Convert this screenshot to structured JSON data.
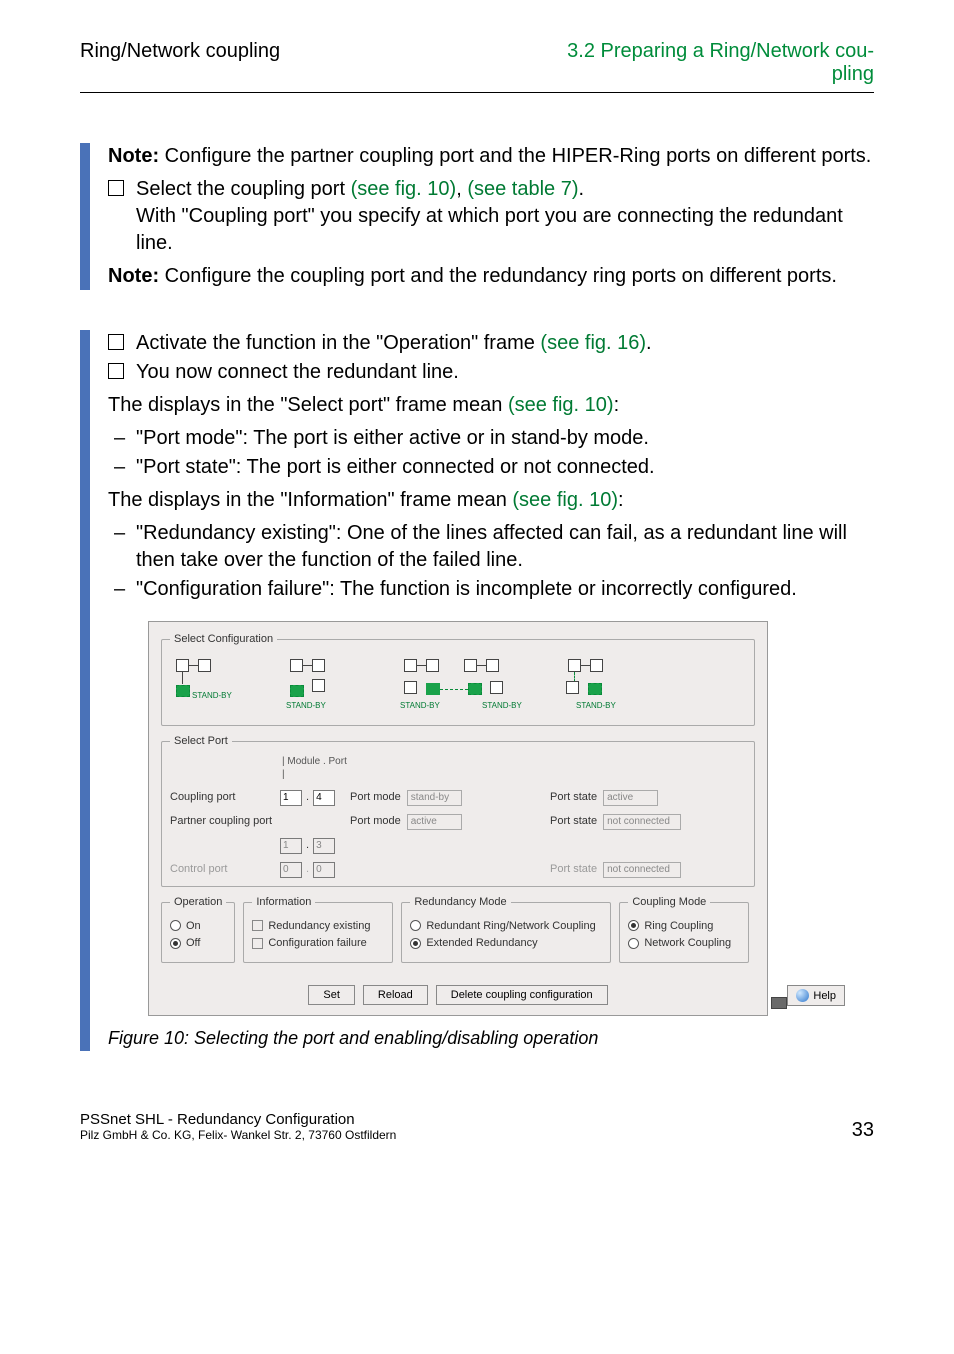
{
  "header": {
    "left": "Ring/Network coupling",
    "right_line1": "3.2  Preparing a Ring/Network cou-",
    "right_line2": "pling"
  },
  "body": {
    "note1_label": "Note:",
    "note1_text": " Configure the partner coupling port and the HIPER-Ring ports on different ports.",
    "check1a": "Select the coupling port ",
    "check1_link1": "(see fig. 10)",
    "check1_sep": ", ",
    "check1_link2": "(see table 7)",
    "check1_end": ".",
    "check1_sub": "With \"Coupling port\" you specify at which port you are connecting the redundant line.",
    "note2_label": "Note:",
    "note2_text": " Configure the coupling port and the redundancy ring ports on different ports.",
    "check2": "Activate the function in the \"Operation\" frame ",
    "check2_link": "(see fig. 16)",
    "check2_end": ".",
    "check3": "You now connect the redundant line.",
    "disp1_a": "The displays in the \"Select port\" frame mean ",
    "disp1_link": "(see fig. 10)",
    "disp1_end": ":",
    "d1_li1": "\"Port mode\": The port is either active or in stand-by mode.",
    "d1_li2": "\"Port state\": The port is either connected or not connected.",
    "disp2_a": "The displays in the \"Information\" frame mean ",
    "disp2_link": "(see fig. 10)",
    "disp2_end": ":",
    "d2_li1": "\"Redundancy existing\": One of the lines affected can fail, as a redundant line will then take over the function of the failed line.",
    "d2_li2": "\"Configuration failure\": The function is incomplete or incorrectly configured."
  },
  "screenshot": {
    "select_configuration": "Select Configuration",
    "standby_label": "STAND-BY",
    "select_port": {
      "legend": "Select Port",
      "module_port": "| Module . Port |",
      "rows": {
        "coupling": {
          "label": "Coupling port",
          "mod": "1",
          "port": "4",
          "mode_label": "Port mode",
          "mode_val": "stand-by",
          "state_label": "Port state",
          "state_val": "active"
        },
        "partner": {
          "label": "Partner coupling port",
          "mod": "1",
          "port": "3",
          "mode_label": "Port mode",
          "mode_val": "active",
          "state_label": "Port state",
          "state_val": "not connected"
        },
        "control": {
          "label": "Control port",
          "mod": "0",
          "port": "0",
          "state_label": "Port state",
          "state_val": "not connected"
        }
      }
    },
    "operation": {
      "legend": "Operation",
      "on": "On",
      "off": "Off"
    },
    "information": {
      "legend": "Information",
      "redundancy": "Redundancy existing",
      "config_fail": "Configuration failure"
    },
    "redundancy_mode": {
      "legend": "Redundancy Mode",
      "opt1": "Redundant Ring/Network Coupling",
      "opt2": "Extended Redundancy"
    },
    "coupling_mode": {
      "legend": "Coupling Mode",
      "opt1": "Ring Coupling",
      "opt2": "Network Coupling"
    },
    "buttons": {
      "set": "Set",
      "reload": "Reload",
      "delete": "Delete coupling configuration",
      "help": "Help"
    }
  },
  "caption": "Figure 10: Selecting the port and enabling/disabling operation",
  "footer": {
    "l1": "PSSnet SHL - Redundancy Configuration",
    "l2": "Pilz GmbH & Co. KG, Felix- Wankel Str. 2, 73760 Ostfildern",
    "page": "33"
  }
}
